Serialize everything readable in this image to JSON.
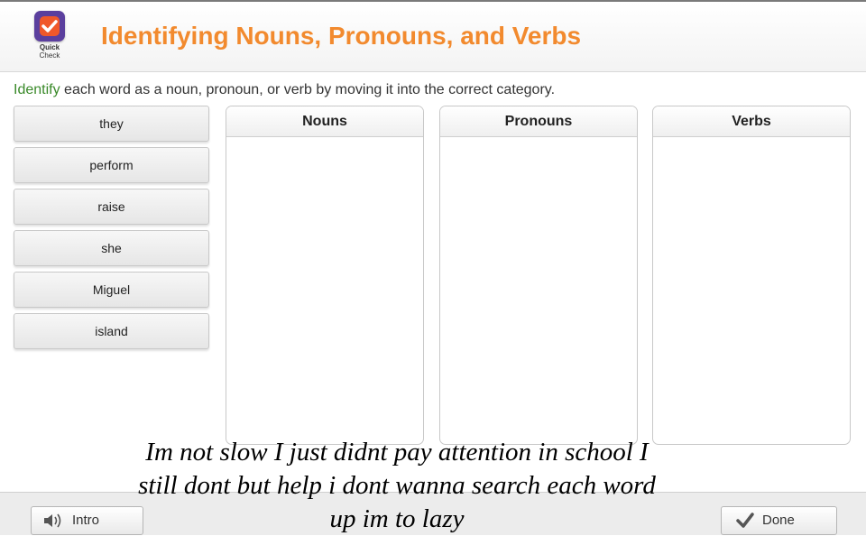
{
  "header": {
    "logo_line1": "Quick",
    "logo_line2": "Check",
    "title": "Identifying Nouns, Pronouns, and Verbs"
  },
  "instruction": {
    "highlight": "Identify",
    "rest": " each word as a noun, pronoun, or verb by moving it into the correct category."
  },
  "words": [
    "they",
    "perform",
    "raise",
    "she",
    "Miguel",
    "island"
  ],
  "categories": [
    "Nouns",
    "Pronouns",
    "Verbs"
  ],
  "footer": {
    "intro_label": "Intro",
    "done_label": "Done"
  },
  "caption": {
    "line1": "Im not slow I just didnt pay attention in school I",
    "line2": "still dont but help i dont wanna search each word",
    "line3": "up im to lazy"
  },
  "colors": {
    "title": "#f28a2e",
    "highlight": "#3a8a2a",
    "logo_badge": "#5b3f9e",
    "logo_inner": "#f0582a"
  }
}
